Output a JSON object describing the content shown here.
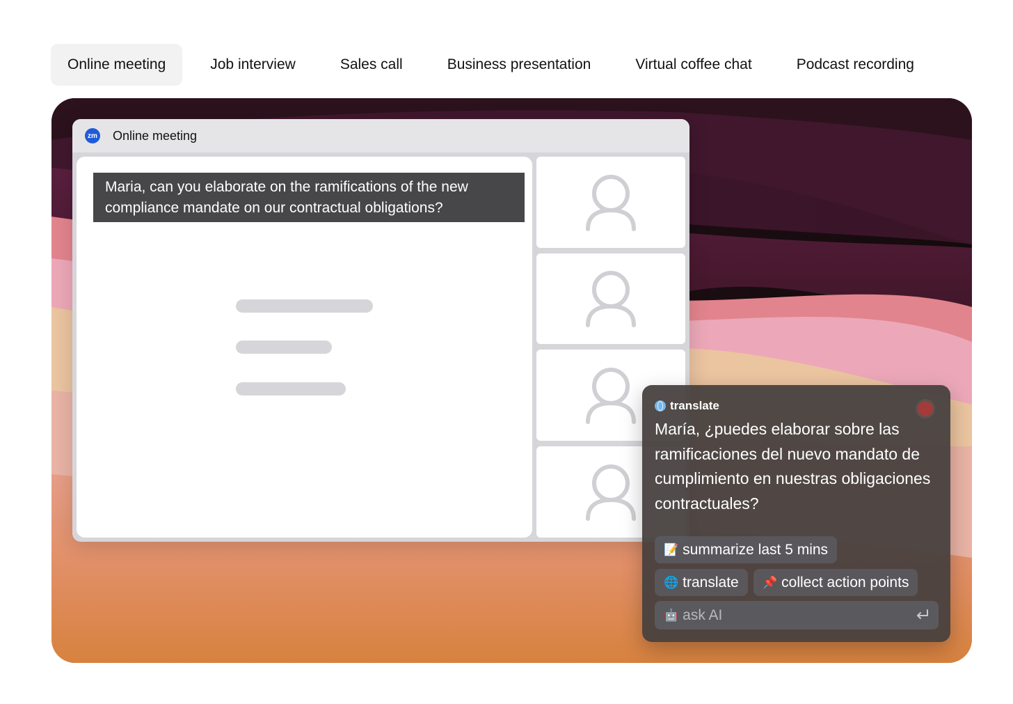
{
  "tabs": [
    {
      "label": "Online meeting",
      "active": true
    },
    {
      "label": "Job interview",
      "active": false
    },
    {
      "label": "Sales call",
      "active": false
    },
    {
      "label": "Business presentation",
      "active": false
    },
    {
      "label": "Virtual coffee chat",
      "active": false
    },
    {
      "label": "Podcast recording",
      "active": false
    }
  ],
  "meeting_window": {
    "app_logo_text": "zm",
    "title": "Online meeting",
    "caption": "Maria, can you elaborate on the ramifications of the new compliance mandate on our contractual obligations?",
    "participant_icon": "person-outline-icon"
  },
  "ai_panel": {
    "mode_label": "translate",
    "translation": "María, ¿puedes elaborar sobre las ramificaciones del nuevo mandato de cumplimiento en nuestras obligaciones contractuales?",
    "actions": [
      {
        "emoji": "📝",
        "label": "summarize last 5 mins"
      },
      {
        "emoji": "🌐",
        "label": "translate"
      },
      {
        "emoji": "📌",
        "label": "collect action points"
      }
    ],
    "ask_emoji": "🤖",
    "ask_placeholder": "ask AI"
  },
  "colors": {
    "tab_active_bg": "#f2f2f2",
    "caption_bg": "#474749",
    "record_dot": "#a33b3b",
    "panel_bg": "#46403e"
  }
}
